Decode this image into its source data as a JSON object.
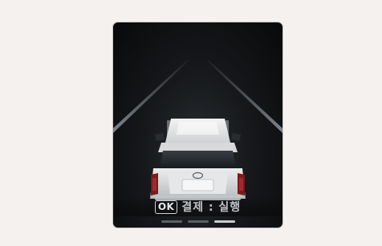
{
  "prompt": {
    "ok_label": "OK",
    "text": "결제 : 실행"
  },
  "pager": {
    "pages": 3,
    "active_index": 2
  },
  "colors": {
    "page_background": "#f4f1ef",
    "screen_background": "#0b0c0e",
    "lane_line": "#7d848c",
    "car_body": "#e4e5e6",
    "tail_light": "#8a1d1d"
  }
}
